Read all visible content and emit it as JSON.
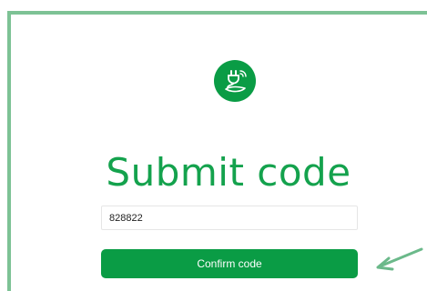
{
  "page": {
    "title": "Submit code"
  },
  "form": {
    "code_value": "828822",
    "confirm_label": "Confirm code"
  },
  "colors": {
    "brand_green": "#0a9c45",
    "title_green": "#14a24d",
    "frame_green": "#7dc295",
    "arrow_green": "#6bb98a"
  },
  "icons": {
    "logo": "plug-leaf-logo-icon",
    "annotation": "arrow-annotation-icon"
  }
}
